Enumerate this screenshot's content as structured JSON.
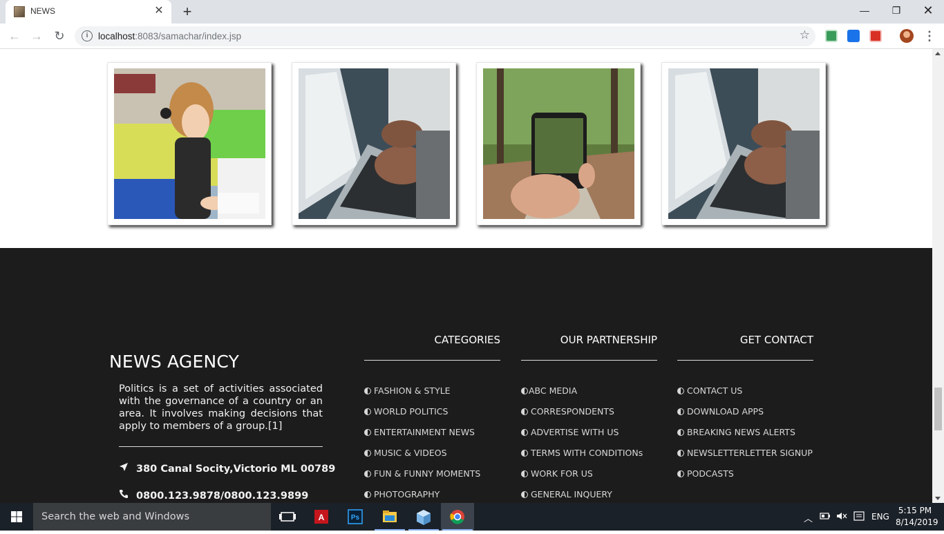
{
  "browser": {
    "tab_title": "NEWS",
    "url_host": "localhost",
    "url_rest": ":8083/samachar/index.jsp"
  },
  "footer": {
    "brand": "NEWS AGENCY",
    "about": "Politics is a set of activities associated with the governance of a country or an area. It involves making decisions that apply to members of a group.[1]",
    "address": "380 Canal Socity,Victorio ML 00789",
    "phone": "0800.123.9878/0800.123.9899",
    "columns": [
      {
        "heading": "CATEGORIES",
        "items": [
          "FASHION & STYLE",
          "WORLD POLITICS",
          "ENTERTAINMENT NEWS",
          "MUSIC & VIDEOS",
          "FUN & FUNNY MOMENTS",
          "PHOTOGRAPHY"
        ]
      },
      {
        "heading": "OUR PARTNERSHIP",
        "items": [
          "ABC MEDIA",
          "CORRESPONDENTS",
          "ADVERTISE WITH US",
          "TERMS WITH CONDITIONs",
          "WORK FOR US",
          "GENERAL INQUERY"
        ]
      },
      {
        "heading": "GET CONTACT",
        "items": [
          "CONTACT US",
          "DOWNLOAD APPS",
          "BREAKING NEWS ALERTS",
          "NEWSLETTERLETTER SIGNUP",
          "PODCASTS"
        ]
      }
    ]
  },
  "gallery": {
    "photos": [
      "girl-drawing-photo",
      "laptop-typing-photo",
      "phone-in-forest-photo",
      "laptop-typing-photo"
    ]
  },
  "taskbar": {
    "search_placeholder": "Search the web and Windows",
    "language": "ENG",
    "time": "5:15 PM",
    "date": "8/14/2019"
  }
}
